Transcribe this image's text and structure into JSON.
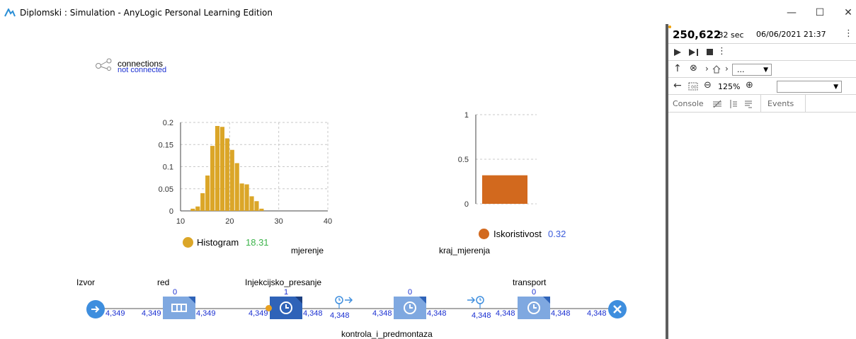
{
  "window": {
    "title": "Diplomski : Simulation - AnyLogic Personal Learning Edition",
    "minimize": "—",
    "maximize": "☐",
    "close": "✕"
  },
  "connections": {
    "label": "connections",
    "status": "not connected"
  },
  "histogram": {
    "y_ticks": [
      "0.2",
      "0.15",
      "0.1",
      "0.05",
      "0"
    ],
    "x_ticks": [
      "10",
      "20",
      "30",
      "40"
    ],
    "legend_label": "Histogram",
    "legend_value": "18.31",
    "color": "#dba628",
    "value_color": "#3cb34a",
    "name": "mjerenje"
  },
  "bar": {
    "y_ticks": [
      "1",
      "0.5",
      "0"
    ],
    "legend_label": "Iskoristivost",
    "legend_value": "0.32",
    "color": "#d2691e",
    "value_color": "#3b5bdb",
    "name": "kraj_mjerenja"
  },
  "chart_data": [
    {
      "type": "bar",
      "title": "",
      "legend": "Histogram",
      "x_range": [
        10,
        40
      ],
      "ylim": [
        0,
        0.2
      ],
      "bins": [
        {
          "x0": 12,
          "x1": 13,
          "y": 0.005
        },
        {
          "x0": 13,
          "x1": 14,
          "y": 0.01
        },
        {
          "x0": 14,
          "x1": 15,
          "y": 0.04
        },
        {
          "x0": 15,
          "x1": 16,
          "y": 0.08
        },
        {
          "x0": 16,
          "x1": 17,
          "y": 0.147
        },
        {
          "x0": 17,
          "x1": 18,
          "y": 0.192
        },
        {
          "x0": 18,
          "x1": 19,
          "y": 0.19
        },
        {
          "x0": 19,
          "x1": 20,
          "y": 0.164
        },
        {
          "x0": 20,
          "x1": 21,
          "y": 0.138
        },
        {
          "x0": 21,
          "x1": 22,
          "y": 0.108
        },
        {
          "x0": 22,
          "x1": 23,
          "y": 0.062
        },
        {
          "x0": 23,
          "x1": 24,
          "y": 0.06
        },
        {
          "x0": 24,
          "x1": 25,
          "y": 0.033
        },
        {
          "x0": 25,
          "x1": 26,
          "y": 0.022
        },
        {
          "x0": 26,
          "x1": 27,
          "y": 0.005
        }
      ]
    },
    {
      "type": "bar",
      "title": "",
      "legend": "Iskoristivost",
      "ylim": [
        0,
        1
      ],
      "categories": [
        "Iskoristivost"
      ],
      "values": [
        0.32
      ]
    }
  ],
  "flow": {
    "source": {
      "name": "Izvor",
      "out": "4,349"
    },
    "queue": {
      "name": "red",
      "count": "0",
      "in": "4,349",
      "out": "4,349"
    },
    "delay1": {
      "name": "Injekcijsko_presanje",
      "count": "1",
      "in": "4,349",
      "out": "4,348"
    },
    "sel1": {
      "out": "4,348"
    },
    "delay2": {
      "name": "kontrola_i_predmontaza",
      "count": "0",
      "in": "4,348",
      "out": "4,348"
    },
    "sel2": {
      "out": "4,348"
    },
    "delay3": {
      "name": "transport",
      "count": "0",
      "in": "4,348",
      "out": "4,348"
    },
    "sink": {
      "in": "4,348"
    }
  },
  "panel": {
    "time_value": "250,622",
    "time_fraction": ".32 sec",
    "datetime": "06/06/2021 21:37",
    "more": "⋮",
    "nav_dropdown": "...",
    "zoom": "125%",
    "tabs": {
      "console": "Console",
      "events": "Events"
    }
  }
}
